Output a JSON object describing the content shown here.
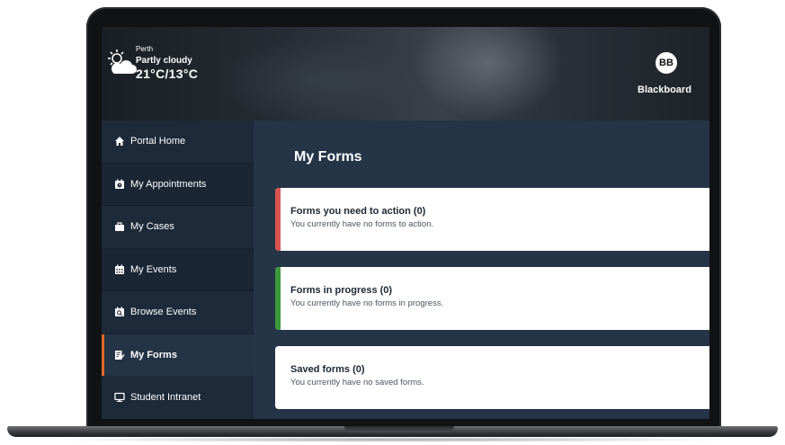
{
  "weather": {
    "city": "Perth",
    "condition": "Partly cloudy",
    "temperature": "21°C/13°C",
    "icon": "partly-cloudy-icon"
  },
  "brand": {
    "logo_initials": "BB",
    "name": "Blackboard"
  },
  "sidebar": {
    "items": [
      {
        "label": "Portal Home",
        "icon": "home-icon",
        "active": false
      },
      {
        "label": "My Appointments",
        "icon": "calendar-clock-icon",
        "active": false
      },
      {
        "label": "My Cases",
        "icon": "briefcase-icon",
        "active": false
      },
      {
        "label": "My Events",
        "icon": "calendar-icon",
        "active": false
      },
      {
        "label": "Browse Events",
        "icon": "calendar-search-icon",
        "active": false
      },
      {
        "label": "My Forms",
        "icon": "form-edit-icon",
        "active": true
      },
      {
        "label": "Student Intranet",
        "icon": "monitor-icon",
        "active": false
      }
    ],
    "active_accent": "#e0682b"
  },
  "main": {
    "title": "My Forms",
    "cards": [
      {
        "title": "Forms you need to action (0)",
        "description": "You currently have no forms to action.",
        "accent": "#d9534f"
      },
      {
        "title": "Forms in progress (0)",
        "description": "You currently have no forms in progress.",
        "accent": "#3c9a3c"
      },
      {
        "title": "Saved forms (0)",
        "description": "You currently have no saved forms.",
        "accent": "#ffffff"
      }
    ]
  }
}
